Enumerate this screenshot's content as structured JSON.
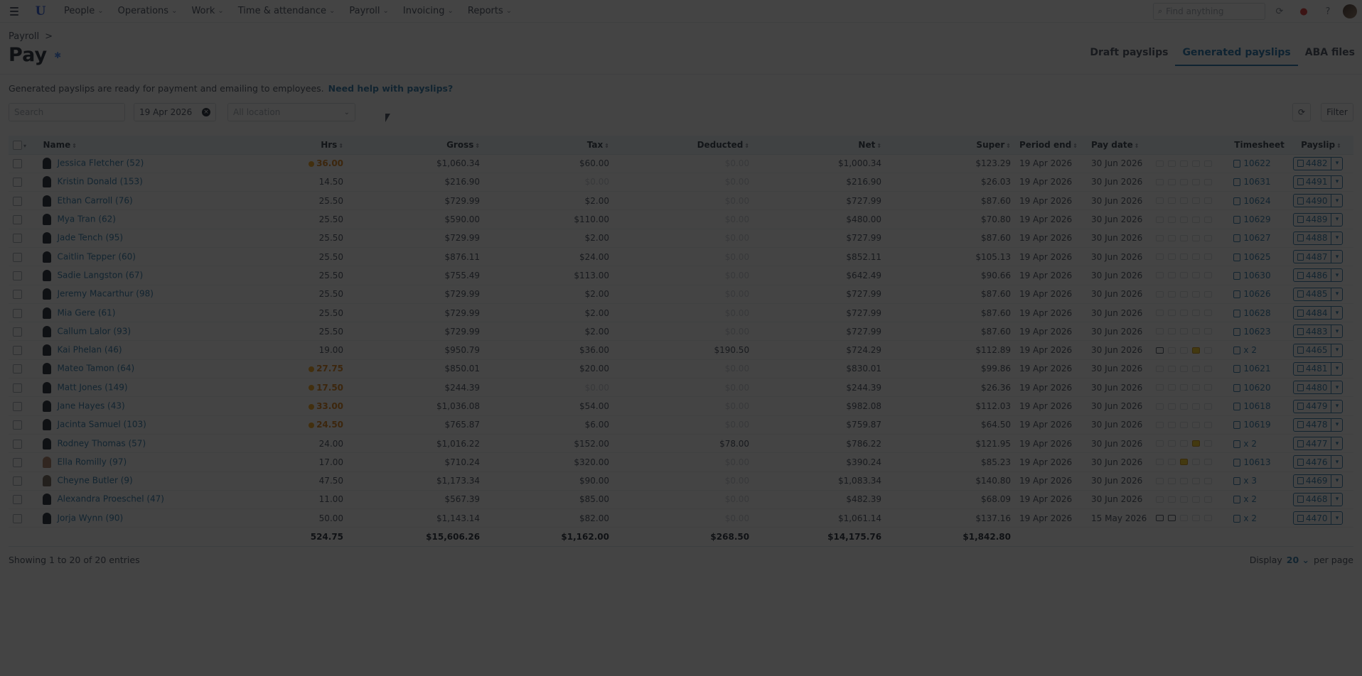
{
  "nav": {
    "items": [
      {
        "label": "People"
      },
      {
        "label": "Operations"
      },
      {
        "label": "Work"
      },
      {
        "label": "Time & attendance"
      },
      {
        "label": "Payroll"
      },
      {
        "label": "Invoicing"
      },
      {
        "label": "Reports"
      }
    ],
    "search_placeholder": "Find anything"
  },
  "breadcrumb": {
    "parent": "Payroll",
    "separator": ">"
  },
  "page": {
    "title": "Pay"
  },
  "tabs": [
    {
      "label": "Draft payslips",
      "active": false
    },
    {
      "label": "Generated payslips",
      "active": true
    },
    {
      "label": "ABA files",
      "active": false
    }
  ],
  "info": {
    "text": "Generated payslips are ready for payment and emailing to employees.",
    "link": "Need help with payslips?"
  },
  "filters": {
    "search_placeholder": "Search",
    "date": "19 Apr 2026",
    "location_placeholder": "All location",
    "filter_label": "Filter"
  },
  "table": {
    "headers": {
      "name": "Name",
      "hrs": "Hrs",
      "gross": "Gross",
      "tax": "Tax",
      "deducted": "Deducted",
      "net": "Net",
      "super": "Super",
      "period_end": "Period end",
      "pay_date": "Pay date",
      "timesheet": "Timesheet",
      "payslip": "Payslip"
    },
    "rows": [
      {
        "name": "Jessica Fletcher (52)",
        "hrs": "36.00",
        "ot": true,
        "gross": "$1,060.34",
        "tax": "$60.00",
        "deducted": "$0.00",
        "net": "$1,000.34",
        "super": "$123.29",
        "period_end": "19 Apr 2026",
        "pay_date": "30 Jun 2026",
        "timesheet": "10622",
        "payslip": "4482"
      },
      {
        "name": "Kristin Donald (153)",
        "hrs": "14.50",
        "ot": false,
        "gross": "$216.90",
        "tax": "$0.00",
        "deducted": "$0.00",
        "net": "$216.90",
        "super": "$26.03",
        "period_end": "19 Apr 2026",
        "pay_date": "30 Jun 2026",
        "timesheet": "10631",
        "payslip": "4491"
      },
      {
        "name": "Ethan Carroll (76)",
        "hrs": "25.50",
        "ot": false,
        "gross": "$729.99",
        "tax": "$2.00",
        "deducted": "$0.00",
        "net": "$727.99",
        "super": "$87.60",
        "period_end": "19 Apr 2026",
        "pay_date": "30 Jun 2026",
        "timesheet": "10624",
        "payslip": "4490"
      },
      {
        "name": "Mya Tran (62)",
        "hrs": "25.50",
        "ot": false,
        "gross": "$590.00",
        "tax": "$110.00",
        "deducted": "$0.00",
        "net": "$480.00",
        "super": "$70.80",
        "period_end": "19 Apr 2026",
        "pay_date": "30 Jun 2026",
        "timesheet": "10629",
        "payslip": "4489"
      },
      {
        "name": "Jade Tench (95)",
        "hrs": "25.50",
        "ot": false,
        "gross": "$729.99",
        "tax": "$2.00",
        "deducted": "$0.00",
        "net": "$727.99",
        "super": "$87.60",
        "period_end": "19 Apr 2026",
        "pay_date": "30 Jun 2026",
        "timesheet": "10627",
        "payslip": "4488"
      },
      {
        "name": "Caitlin Tepper (60)",
        "hrs": "25.50",
        "ot": false,
        "gross": "$876.11",
        "tax": "$24.00",
        "deducted": "$0.00",
        "net": "$852.11",
        "super": "$105.13",
        "period_end": "19 Apr 2026",
        "pay_date": "30 Jun 2026",
        "timesheet": "10625",
        "payslip": "4487"
      },
      {
        "name": "Sadie Langston (67)",
        "hrs": "25.50",
        "ot": false,
        "gross": "$755.49",
        "tax": "$113.00",
        "deducted": "$0.00",
        "net": "$642.49",
        "super": "$90.66",
        "period_end": "19 Apr 2026",
        "pay_date": "30 Jun 2026",
        "timesheet": "10630",
        "payslip": "4486"
      },
      {
        "name": "Jeremy Macarthur (98)",
        "hrs": "25.50",
        "ot": false,
        "gross": "$729.99",
        "tax": "$2.00",
        "deducted": "$0.00",
        "net": "$727.99",
        "super": "$87.60",
        "period_end": "19 Apr 2026",
        "pay_date": "30 Jun 2026",
        "timesheet": "10626",
        "payslip": "4485"
      },
      {
        "name": "Mia Gere (61)",
        "hrs": "25.50",
        "ot": false,
        "gross": "$729.99",
        "tax": "$2.00",
        "deducted": "$0.00",
        "net": "$727.99",
        "super": "$87.60",
        "period_end": "19 Apr 2026",
        "pay_date": "30 Jun 2026",
        "timesheet": "10628",
        "payslip": "4484"
      },
      {
        "name": "Callum Lalor (93)",
        "hrs": "25.50",
        "ot": false,
        "gross": "$729.99",
        "tax": "$2.00",
        "deducted": "$0.00",
        "net": "$727.99",
        "super": "$87.60",
        "period_end": "19 Apr 2026",
        "pay_date": "30 Jun 2026",
        "timesheet": "10623",
        "payslip": "4483"
      },
      {
        "name": "Kai Phelan (46)",
        "hrs": "19.00",
        "ot": false,
        "gross": "$950.79",
        "tax": "$36.00",
        "deducted": "$190.50",
        "net": "$724.29",
        "super": "$112.89",
        "period_end": "19 Apr 2026",
        "pay_date": "30 Jun 2026",
        "timesheet": "x 2",
        "payslip": "4465"
      },
      {
        "name": "Mateo Tamon (64)",
        "hrs": "27.75",
        "ot": true,
        "gross": "$850.01",
        "tax": "$20.00",
        "deducted": "$0.00",
        "net": "$830.01",
        "super": "$99.86",
        "period_end": "19 Apr 2026",
        "pay_date": "30 Jun 2026",
        "timesheet": "10621",
        "payslip": "4481"
      },
      {
        "name": "Matt Jones (149)",
        "hrs": "17.50",
        "ot": true,
        "gross": "$244.39",
        "tax": "$0.00",
        "deducted": "$0.00",
        "net": "$244.39",
        "super": "$26.36",
        "period_end": "19 Apr 2026",
        "pay_date": "30 Jun 2026",
        "timesheet": "10620",
        "payslip": "4480"
      },
      {
        "name": "Jane Hayes (43)",
        "hrs": "33.00",
        "ot": true,
        "gross": "$1,036.08",
        "tax": "$54.00",
        "deducted": "$0.00",
        "net": "$982.08",
        "super": "$112.03",
        "period_end": "19 Apr 2026",
        "pay_date": "30 Jun 2026",
        "timesheet": "10618",
        "payslip": "4479"
      },
      {
        "name": "Jacinta Samuel (103)",
        "hrs": "24.50",
        "ot": true,
        "gross": "$765.87",
        "tax": "$6.00",
        "deducted": "$0.00",
        "net": "$759.87",
        "super": "$64.50",
        "period_end": "19 Apr 2026",
        "pay_date": "30 Jun 2026",
        "timesheet": "10619",
        "payslip": "4478"
      },
      {
        "name": "Rodney Thomas (57)",
        "hrs": "24.00",
        "ot": false,
        "gross": "$1,016.22",
        "tax": "$152.00",
        "deducted": "$78.00",
        "net": "$786.22",
        "super": "$121.95",
        "period_end": "19 Apr 2026",
        "pay_date": "30 Jun 2026",
        "timesheet": "x 2",
        "payslip": "4477"
      },
      {
        "name": "Ella Romilly (97)",
        "hrs": "17.00",
        "ot": false,
        "gross": "$710.24",
        "tax": "$320.00",
        "deducted": "$0.00",
        "net": "$390.24",
        "super": "$85.23",
        "period_end": "19 Apr 2026",
        "pay_date": "30 Jun 2026",
        "timesheet": "10613",
        "payslip": "4476"
      },
      {
        "name": "Cheyne Butler (9)",
        "hrs": "47.50",
        "ot": false,
        "gross": "$1,173.34",
        "tax": "$90.00",
        "deducted": "$0.00",
        "net": "$1,083.34",
        "super": "$140.80",
        "period_end": "19 Apr 2026",
        "pay_date": "30 Jun 2026",
        "timesheet": "x 3",
        "payslip": "4469"
      },
      {
        "name": "Alexandra Proeschel (47)",
        "hrs": "11.00",
        "ot": false,
        "gross": "$567.39",
        "tax": "$85.00",
        "deducted": "$0.00",
        "net": "$482.39",
        "super": "$68.09",
        "period_end": "19 Apr 2026",
        "pay_date": "30 Jun 2026",
        "timesheet": "x 2",
        "payslip": "4468"
      },
      {
        "name": "Jorja Wynn (90)",
        "hrs": "50.00",
        "ot": false,
        "gross": "$1,143.14",
        "tax": "$82.00",
        "deducted": "$0.00",
        "net": "$1,061.14",
        "super": "$137.16",
        "period_end": "19 Apr 2026",
        "pay_date": "15 May 2026",
        "timesheet": "x 2",
        "payslip": "4470"
      }
    ],
    "totals": {
      "hrs": "524.75",
      "gross": "$15,606.26",
      "tax": "$1,162.00",
      "deducted": "$268.50",
      "net": "$14,175.76",
      "super": "$1,842.80"
    }
  },
  "footer": {
    "showing": "Showing 1 to 20 of 20 entries",
    "display_label": "Display",
    "per_page_value": "20",
    "per_page_label": "per page"
  },
  "colors": {
    "accent": "#1d6fa5",
    "overtime": "#d97706",
    "overlay": "rgba(15,15,15,0.78)"
  }
}
